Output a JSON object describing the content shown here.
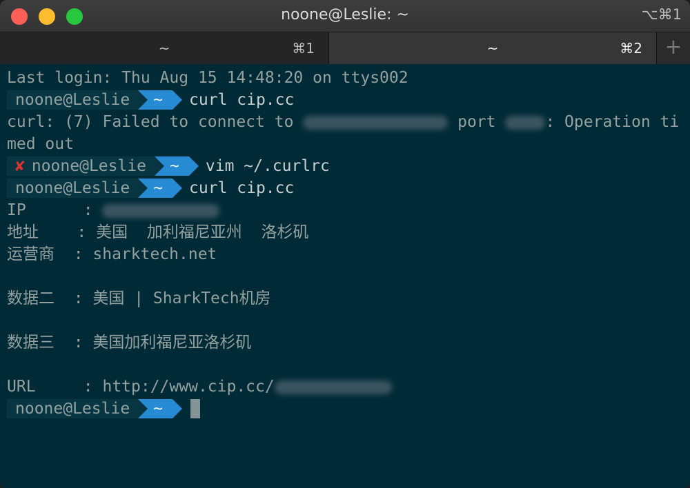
{
  "window": {
    "title": "noone@Leslie: ~",
    "title_shortcut": "⌥⌘1"
  },
  "tabs": [
    {
      "label": "~",
      "shortcut": "⌘1"
    },
    {
      "label": "~",
      "shortcut": "⌘2"
    }
  ],
  "new_tab_label": "+",
  "terminal": {
    "last_login": "Last login: Thu Aug 15 14:48:20 on ttys002",
    "prompt_user": "noone@Leslie",
    "prompt_dir": "~",
    "cmd1": "curl cip.cc",
    "error_prefix": "curl: (7) Failed to connect to ",
    "error_port": " port ",
    "error_suffix": ": Operation ti",
    "error_wrap": "med out",
    "error_mark": "✘",
    "cmd2": "vim ~/.curlrc",
    "cmd3": "curl cip.cc",
    "ip_label": "IP      : ",
    "addr_line": "地址    : 美国  加利福尼亚州  洛杉矶",
    "isp_line": "运营商  : sharktech.net",
    "data2_line": "数据二  : 美国 | SharkTech机房",
    "data3_line": "数据三  : 美国加利福尼亚洛杉矶",
    "url_label": "URL     : http://www.cip.cc/"
  },
  "colors": {
    "background": "#002b36",
    "prompt_segment": "#268bd2",
    "error_mark": "#dc322f"
  }
}
